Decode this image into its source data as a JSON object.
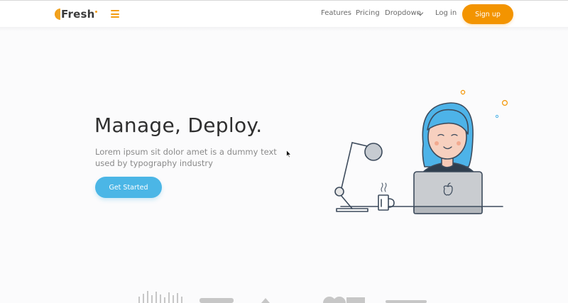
{
  "brand": {
    "name": "Fresh"
  },
  "nav": {
    "links": [
      {
        "label": "Features"
      },
      {
        "label": "Pricing"
      },
      {
        "label": "Dropdown"
      },
      {
        "label": "Log in"
      }
    ],
    "signup_label": "Sign up"
  },
  "hero": {
    "title": "Manage, Deploy.",
    "subtitle": "Lorem ipsum sit dolor amet is a dummy text used by typography industry",
    "cta_label": "Get Started"
  },
  "colors": {
    "accent": "#f39400",
    "primary": "#4bb6e6",
    "hair": "#4db3e8",
    "text": "#2f2f2f"
  },
  "icons": [
    "hamburger-menu-icon",
    "chevron-down-icon",
    "mouse-pointer-icon",
    "apple-logo-icon"
  ]
}
